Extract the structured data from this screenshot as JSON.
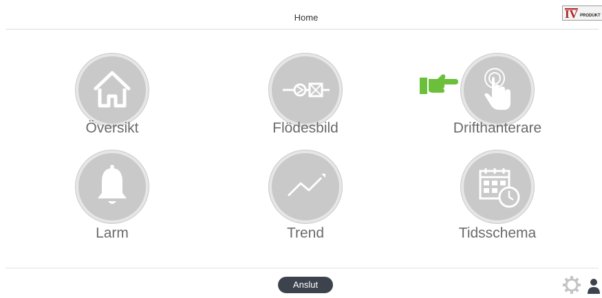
{
  "header": {
    "title": "Home",
    "logo_text": "IV PRODUKT"
  },
  "tiles": [
    {
      "label": "Översikt",
      "icon": "house-icon"
    },
    {
      "label": "Flödesbild",
      "icon": "flow-diagram-icon"
    },
    {
      "label": "Drifthanterare",
      "icon": "touch-hand-icon"
    },
    {
      "label": "Larm",
      "icon": "bell-icon"
    },
    {
      "label": "Trend",
      "icon": "trend-line-icon"
    },
    {
      "label": "Tidsschema",
      "icon": "calendar-clock-icon"
    }
  ],
  "pointer": {
    "icon": "pointing-hand-icon",
    "color": "#6cbf3a"
  },
  "footer": {
    "connect_label": "Anslut",
    "settings_icon": "gear-icon",
    "user_icon": "user-icon"
  },
  "colors": {
    "icon_circle": "#c9c9c9",
    "icon_glyph": "#ffffff",
    "label": "#6a6a6a",
    "button": "#3d434d"
  }
}
